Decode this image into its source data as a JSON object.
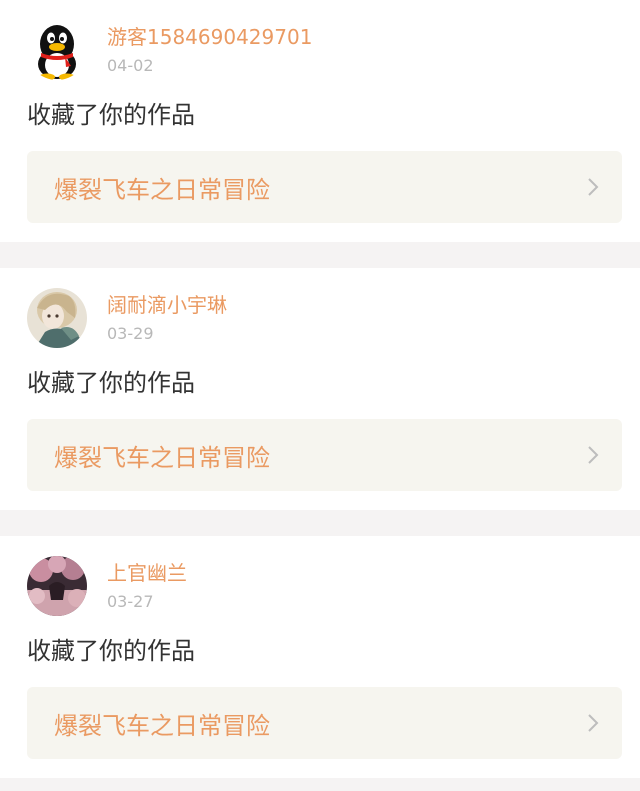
{
  "notifications": [
    {
      "username": "游客1584690429701",
      "date": "04-02",
      "action": "收藏了你的作品",
      "work_title": "爆裂飞车之日常冒险",
      "avatar_icon": "qq-penguin-icon"
    },
    {
      "username": "阔耐滴小宇琳",
      "date": "03-29",
      "action": "收藏了你的作品",
      "work_title": "爆裂飞车之日常冒险",
      "avatar_icon": "anime-girl-avatar"
    },
    {
      "username": "上官幽兰",
      "date": "03-27",
      "action": "收藏了你的作品",
      "work_title": "爆裂飞车之日常冒险",
      "avatar_icon": "sakura-tree-avatar"
    }
  ],
  "colors": {
    "accent": "#ea9a62",
    "date": "#b8b8b8",
    "link_bg": "#f6f5ef",
    "page_bg": "#f5f3f3"
  }
}
